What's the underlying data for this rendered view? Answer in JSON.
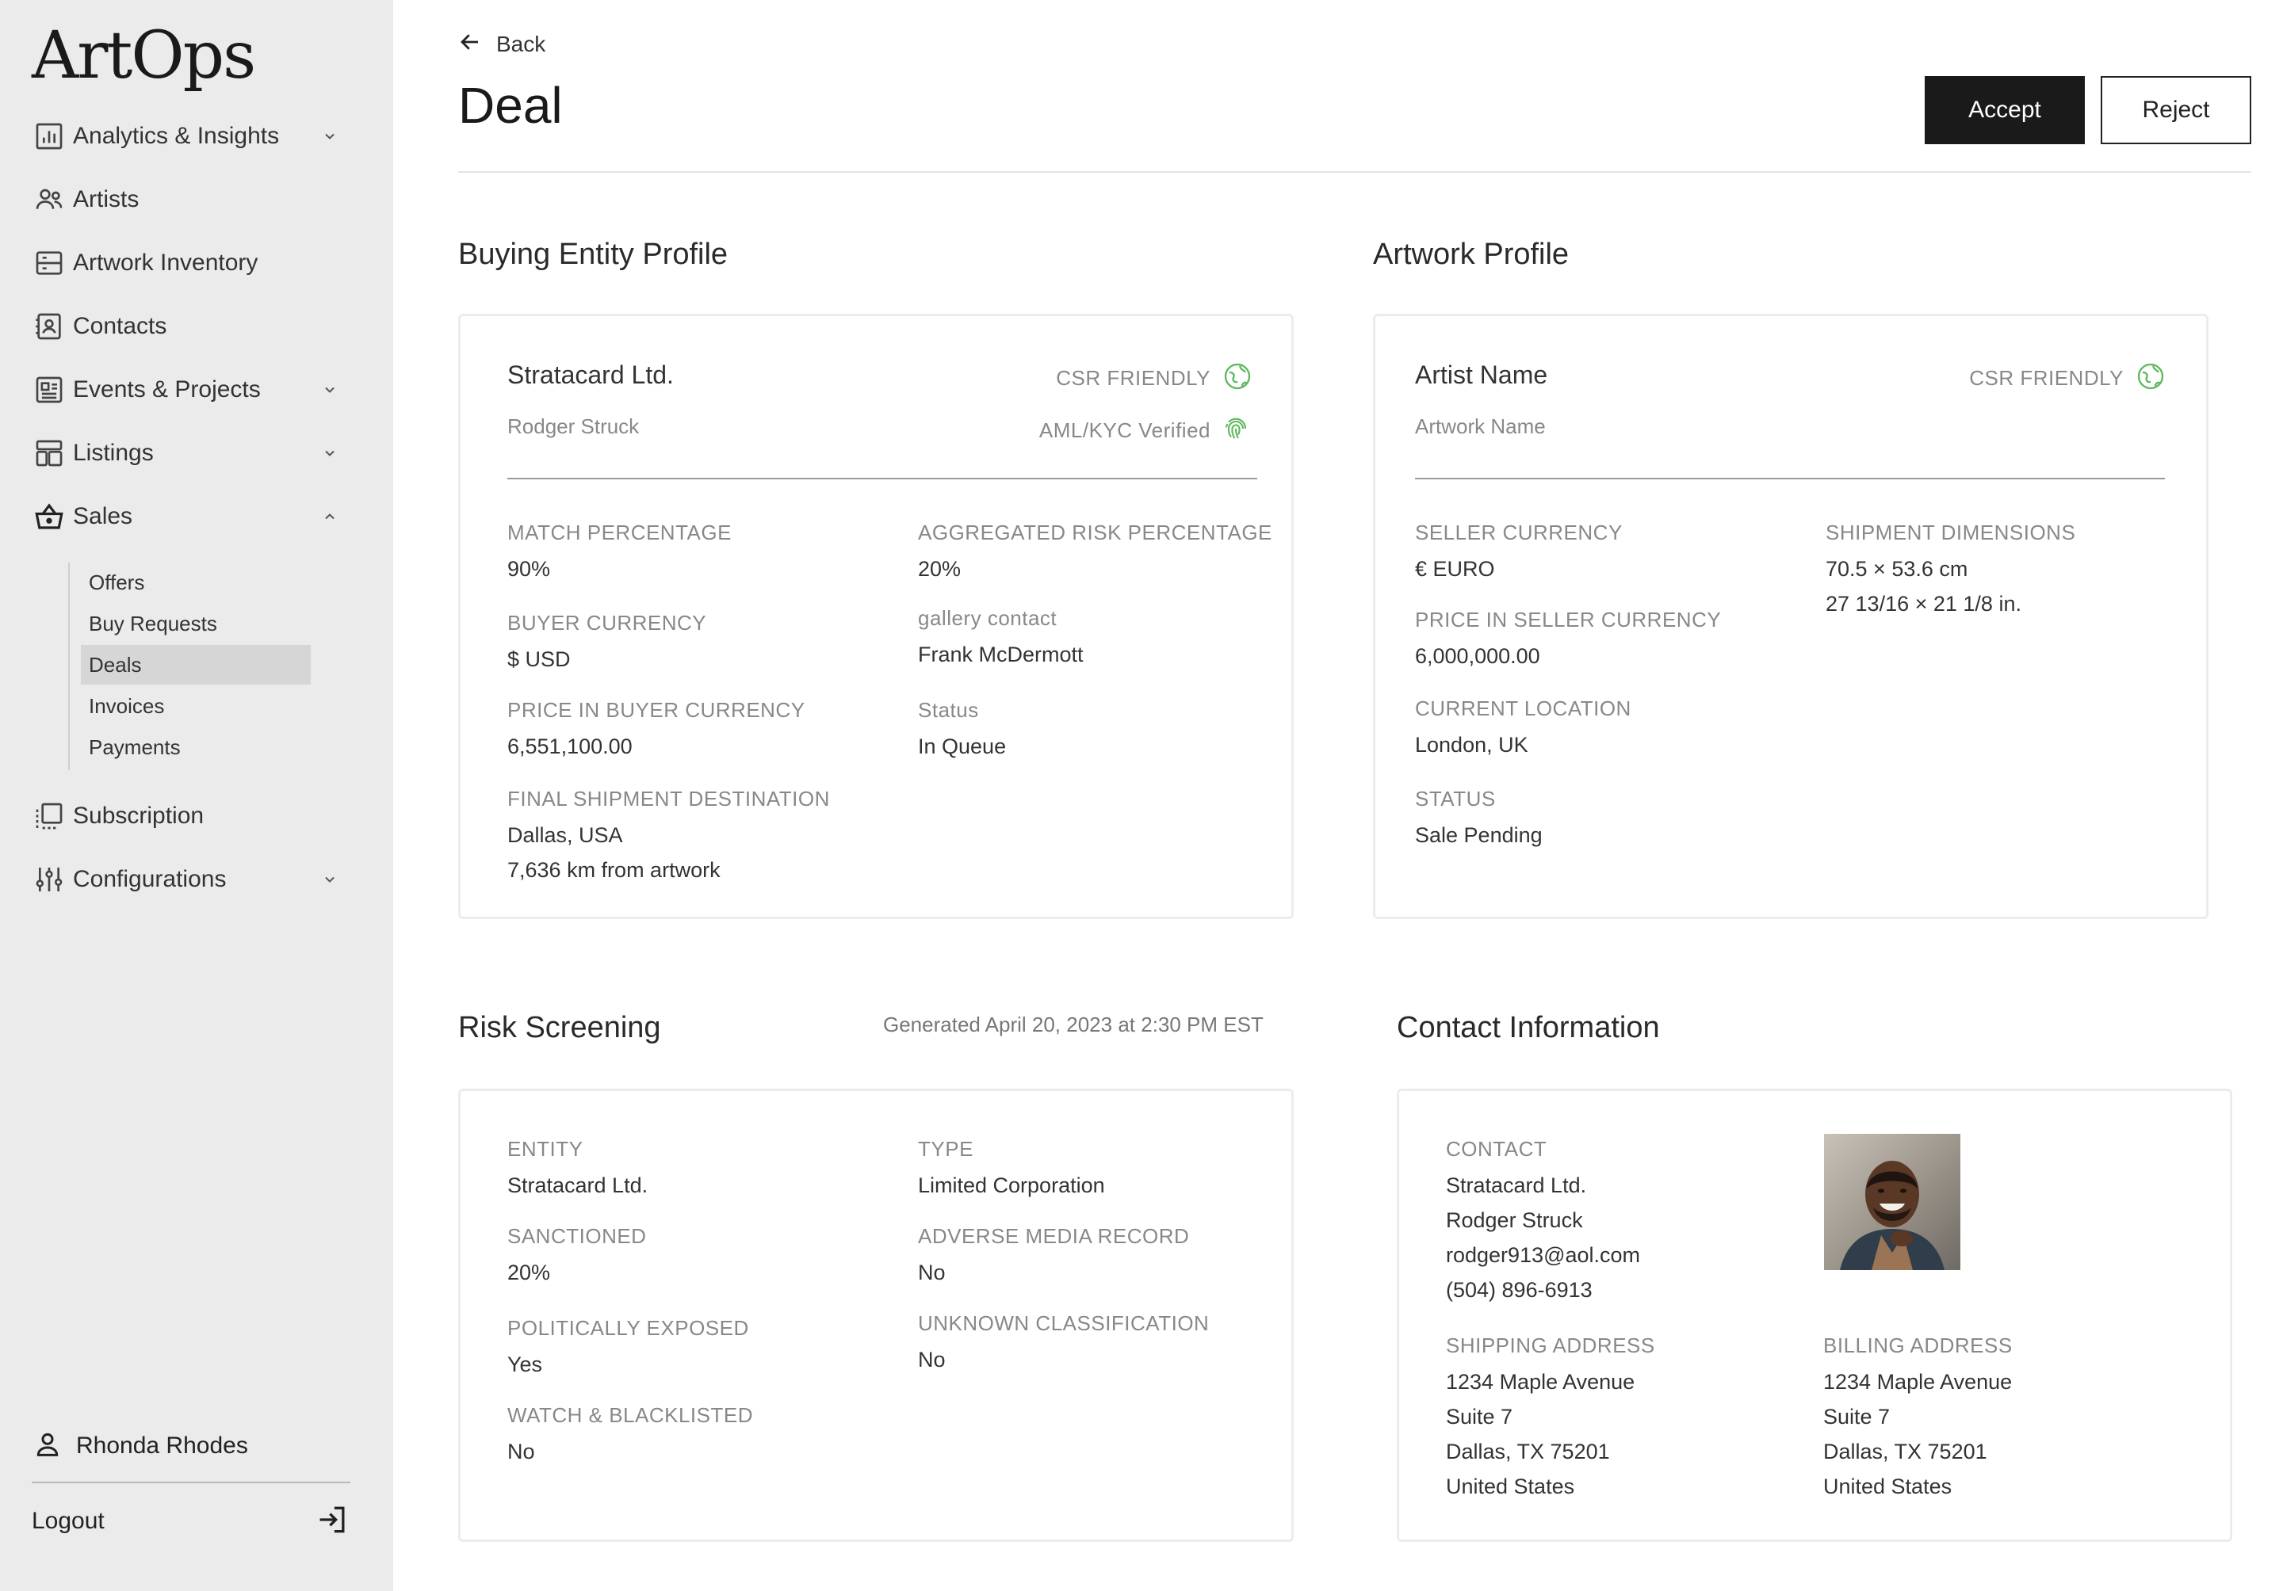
{
  "app": {
    "logo": "ArtOps"
  },
  "sidebar": {
    "items": [
      {
        "label": "Analytics & Insights",
        "icon": "chart-icon",
        "expandable": true,
        "expanded": false
      },
      {
        "label": "Artists",
        "icon": "users-icon",
        "expandable": false
      },
      {
        "label": "Artwork Inventory",
        "icon": "inventory-icon",
        "expandable": false
      },
      {
        "label": "Contacts",
        "icon": "contacts-icon",
        "expandable": false
      },
      {
        "label": "Events & Projects",
        "icon": "events-icon",
        "expandable": true,
        "expanded": false
      },
      {
        "label": "Listings",
        "icon": "listings-icon",
        "expandable": true,
        "expanded": false
      },
      {
        "label": "Sales",
        "icon": "basket-icon",
        "expandable": true,
        "expanded": true
      },
      {
        "label": "Subscription",
        "icon": "subscription-icon",
        "expandable": false
      },
      {
        "label": "Configurations",
        "icon": "sliders-icon",
        "expandable": true,
        "expanded": false
      }
    ],
    "sales_sub": [
      {
        "label": "Offers",
        "active": false
      },
      {
        "label": "Buy Requests",
        "active": false
      },
      {
        "label": "Deals",
        "active": true
      },
      {
        "label": "Invoices",
        "active": false
      },
      {
        "label": "Payments",
        "active": false
      }
    ],
    "user": "Rhonda Rhodes",
    "logout": "Logout"
  },
  "header": {
    "back": "Back",
    "title": "Deal",
    "accept": "Accept",
    "reject": "Reject"
  },
  "buying_entity": {
    "section_title": "Buying Entity Profile",
    "name": "Stratacard Ltd.",
    "contact": "Rodger Struck",
    "badge_csr": "CSR FRIENDLY",
    "badge_aml": "AML/KYC Verified",
    "fields": {
      "match_pct_label": "MATCH PERCENTAGE",
      "match_pct": "90%",
      "risk_pct_label": "AGGREGATED RISK PERCENTAGE",
      "risk_pct": "20%",
      "buyer_currency_label": "BUYER CURRENCY",
      "buyer_currency": "$ USD",
      "gallery_contact_label": "gallery contact",
      "gallery_contact": "Frank McDermott",
      "price_buyer_label": "PRICE IN BUYER CURRENCY",
      "price_buyer": "6,551,100.00",
      "status_label": "Status",
      "status": "In Queue",
      "destination_label": "FINAL SHIPMENT DESTINATION",
      "destination": "Dallas, USA",
      "distance": "7,636 km from artwork"
    }
  },
  "artwork": {
    "section_title": "Artwork Profile",
    "artist": "Artist Name",
    "artwork": "Artwork Name",
    "badge_csr": "CSR FRIENDLY",
    "fields": {
      "seller_currency_label": "SELLER CURRENCY",
      "seller_currency": "€ EURO",
      "dimensions_label": "SHIPMENT DIMENSIONS",
      "dimensions_cm": "70.5 × 53.6 cm",
      "dimensions_in": "27 13/16 × 21 1/8 in.",
      "price_seller_label": "PRICE IN SELLER CURRENCY",
      "price_seller": "6,000,000.00",
      "location_label": "CURRENT LOCATION",
      "location": "London, UK",
      "status_label": "STATUS",
      "status": "Sale Pending"
    }
  },
  "risk": {
    "section_title": "Risk Screening",
    "generated": "Generated April 20, 2023 at 2:30 PM EST",
    "fields": {
      "entity_label": "ENTITY",
      "entity": "Stratacard Ltd.",
      "type_label": "TYPE",
      "type": "Limited Corporation",
      "sanctioned_label": "SANCTIONED",
      "sanctioned": "20%",
      "adverse_label": "ADVERSE MEDIA RECORD",
      "adverse": "No",
      "pep_label": "POLITICALLY EXPOSED",
      "pep": "Yes",
      "unknown_label": "UNKNOWN CLASSIFICATION",
      "unknown": "No",
      "watch_label": "WATCH & BLACKLISTED",
      "watch": "No"
    }
  },
  "contact": {
    "section_title": "Contact Information",
    "contact_label": "CONTACT",
    "company": "Stratacard Ltd.",
    "person": "Rodger Struck",
    "email": "rodger913@aol.com",
    "phone": "(504) 896-6913",
    "shipping_label": "SHIPPING ADDRESS",
    "shipping": [
      "1234 Maple Avenue",
      "Suite 7",
      "Dallas, TX 75201",
      "United States"
    ],
    "billing_label": "BILLING ADDRESS",
    "billing": [
      "1234 Maple Avenue",
      "Suite 7",
      "Dallas, TX 75201",
      "United States"
    ]
  },
  "colors": {
    "accent_green": "#5cb85c",
    "button_dark": "#1a1a1a",
    "sidebar_bg": "#ebebeb"
  }
}
